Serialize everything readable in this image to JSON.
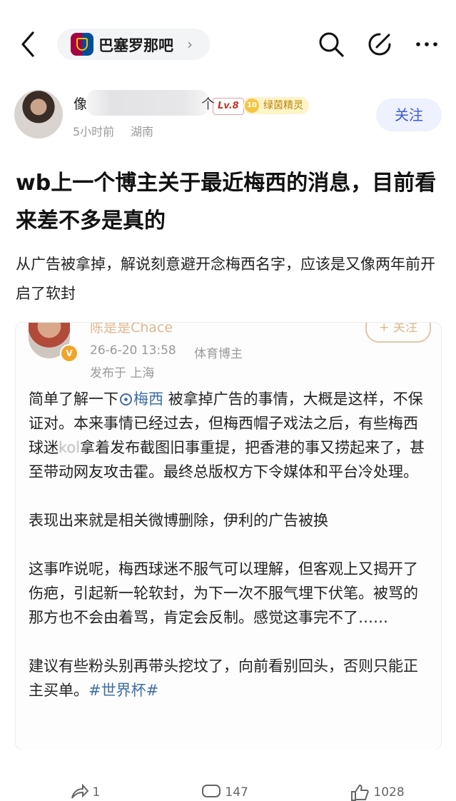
{
  "header": {
    "forum_name": "巴塞罗那吧",
    "forum_chevron": "›",
    "back_icon": "chevron-left-icon",
    "search_icon": "search-icon",
    "edit_icon": "edit-icon",
    "more_icon": "more-horizontal-icon"
  },
  "author": {
    "name": "像",
    "name_tail": "个",
    "level": "Lv.8",
    "medal_num": "10",
    "medal": "绿茵精灵",
    "time": "5小时前",
    "location": "湖南",
    "follow_label": "关注"
  },
  "post": {
    "title": "wb上一个博主关于最近梅西的消息，目前看来差不多是真的",
    "subtitle": "从广告被拿掉，解说刻意避开念梅西名字，应该是又像两年前开启了软封"
  },
  "weibo_card": {
    "name": "陈是是Chace",
    "follow_label": "+ 关注",
    "date": "26-6-20 13:58",
    "tag": "体育博主",
    "published": "发布于 上海",
    "p1_a": "简单了解一下",
    "p1_link": "梅西",
    "p1_b": " 被拿掉广告的事情，大概是这样，不保证对。本来事情已经过去，但梅西帽子戏法之后，有些梅西球迷",
    "p1_blur": "kol",
    "p1_c": "拿着发布截图旧事重提，把香港的事又捞起来了，甚至带动网友攻击霍。最终总版权方下令媒体和平台冷处理。",
    "p2": "表现出来就是相关微博删除，伊利的广告被换",
    "p3": "这事咋说呢，梅西球迷不服气可以理解，但客观上又揭开了伤疤，引起新一轮软封，为下一次不服气埋下伏笔。被骂的那方也不会由着骂，肯定会反制。感觉这事完不了……",
    "p4_a": "建议有些粉头别再带头挖坟了，向前看别回头，否则只能正主买单。",
    "p4_tag": "#世界杯#"
  },
  "actions": {
    "share_count": "1",
    "comment_count": "147",
    "like_count": "1028"
  },
  "colors": {
    "accent_blue": "#3d5bd8",
    "link": "#3f6ea8",
    "level_red": "#c0392b",
    "medal_gold": "#b7860b"
  }
}
